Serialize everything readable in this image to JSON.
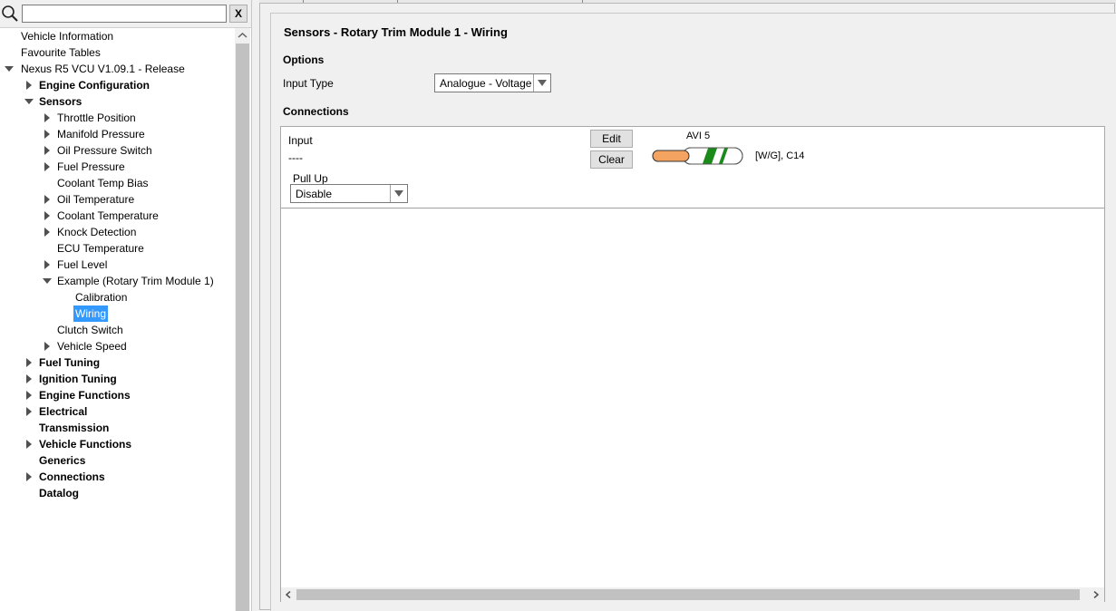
{
  "search": {
    "placeholder": "",
    "value": "",
    "clear_label": "X"
  },
  "tree": [
    {
      "label": "Vehicle Information",
      "bold": false,
      "level": 0,
      "arrow": "none",
      "selected": false
    },
    {
      "label": "Favourite Tables",
      "bold": false,
      "level": 0,
      "arrow": "none",
      "selected": false
    },
    {
      "label": "Nexus R5 VCU V1.09.1 - Release",
      "bold": false,
      "level": 0,
      "arrow": "down",
      "selected": false
    },
    {
      "label": "Engine Configuration",
      "bold": true,
      "level": 1,
      "arrow": "right",
      "selected": false
    },
    {
      "label": "Sensors",
      "bold": true,
      "level": 1,
      "arrow": "down",
      "selected": false
    },
    {
      "label": "Throttle Position",
      "bold": false,
      "level": 2,
      "arrow": "right",
      "selected": false
    },
    {
      "label": "Manifold Pressure",
      "bold": false,
      "level": 2,
      "arrow": "right",
      "selected": false
    },
    {
      "label": "Oil Pressure Switch",
      "bold": false,
      "level": 2,
      "arrow": "right",
      "selected": false
    },
    {
      "label": "Fuel Pressure",
      "bold": false,
      "level": 2,
      "arrow": "right",
      "selected": false
    },
    {
      "label": "Coolant Temp Bias",
      "bold": false,
      "level": 2,
      "arrow": "none",
      "selected": false
    },
    {
      "label": "Oil Temperature",
      "bold": false,
      "level": 2,
      "arrow": "right",
      "selected": false
    },
    {
      "label": "Coolant Temperature",
      "bold": false,
      "level": 2,
      "arrow": "right",
      "selected": false
    },
    {
      "label": "Knock Detection",
      "bold": false,
      "level": 2,
      "arrow": "right",
      "selected": false
    },
    {
      "label": "ECU Temperature",
      "bold": false,
      "level": 2,
      "arrow": "none",
      "selected": false
    },
    {
      "label": "Fuel Level",
      "bold": false,
      "level": 2,
      "arrow": "right",
      "selected": false
    },
    {
      "label": "Example (Rotary Trim Module 1)",
      "bold": false,
      "level": 2,
      "arrow": "down",
      "selected": false
    },
    {
      "label": "Calibration",
      "bold": false,
      "level": 3,
      "arrow": "none",
      "selected": false
    },
    {
      "label": "Wiring",
      "bold": false,
      "level": 3,
      "arrow": "none",
      "selected": true
    },
    {
      "label": "Clutch Switch",
      "bold": false,
      "level": 2,
      "arrow": "none",
      "selected": false
    },
    {
      "label": "Vehicle Speed",
      "bold": false,
      "level": 2,
      "arrow": "right",
      "selected": false
    },
    {
      "label": "Fuel Tuning",
      "bold": true,
      "level": 1,
      "arrow": "right",
      "selected": false
    },
    {
      "label": "Ignition Tuning",
      "bold": true,
      "level": 1,
      "arrow": "right",
      "selected": false
    },
    {
      "label": "Engine Functions",
      "bold": true,
      "level": 1,
      "arrow": "right",
      "selected": false
    },
    {
      "label": "Electrical",
      "bold": true,
      "level": 1,
      "arrow": "right",
      "selected": false
    },
    {
      "label": "Transmission",
      "bold": true,
      "level": 1,
      "arrow": "none",
      "selected": false
    },
    {
      "label": "Vehicle Functions",
      "bold": true,
      "level": 1,
      "arrow": "right",
      "selected": false
    },
    {
      "label": "Generics",
      "bold": true,
      "level": 1,
      "arrow": "none",
      "selected": false
    },
    {
      "label": "Connections",
      "bold": true,
      "level": 1,
      "arrow": "right",
      "selected": false
    },
    {
      "label": "Datalog",
      "bold": true,
      "level": 1,
      "arrow": "none",
      "selected": false
    }
  ],
  "main": {
    "title": "Sensors - Rotary Trim Module 1 - Wiring",
    "options_heading": "Options",
    "input_type_label": "Input Type",
    "input_type_value": "Analogue - Voltage",
    "connections_heading": "Connections",
    "input_label": "Input",
    "input_value": "----",
    "edit_label": "Edit",
    "clear_label": "Clear",
    "pin_label": "AVI 5",
    "wire_info": "[W/G], C14",
    "pullup_label": "Pull Up",
    "pullup_value": "Disable"
  },
  "colors": {
    "selection": "#3399ff",
    "wire_orange": "#f4a460",
    "wire_green": "#1a8a1a",
    "wire_white": "#ffffff"
  }
}
